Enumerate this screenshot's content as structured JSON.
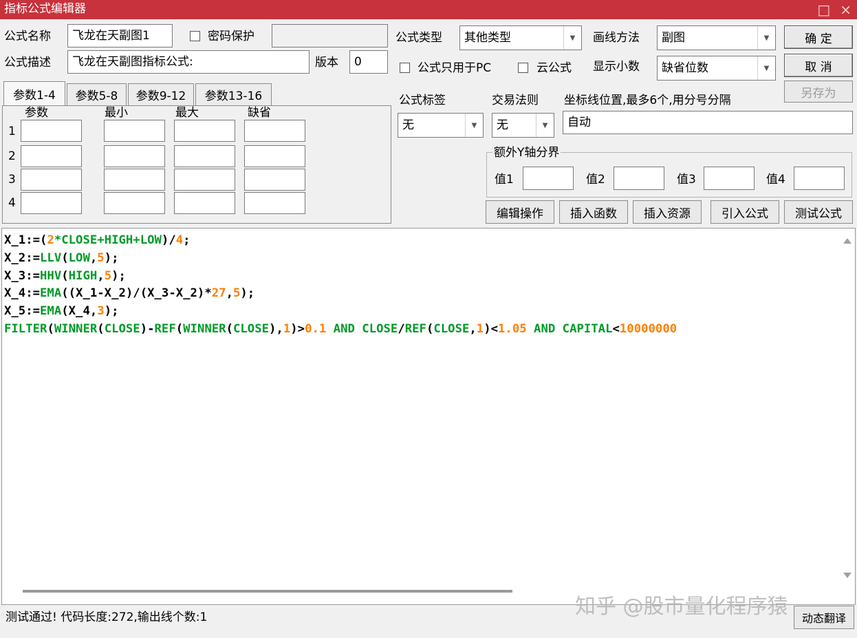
{
  "window": {
    "title": "指标公式编辑器",
    "maximize_glyph": "□",
    "close_glyph": "×"
  },
  "form": {
    "name_label": "公式名称",
    "name_value": "飞龙在天副图1",
    "password_label": "密码保护",
    "desc_label": "公式描述",
    "desc_value": "飞龙在天副图指标公式:",
    "version_label": "版本",
    "version_value": "0",
    "type_label": "公式类型",
    "type_value": "其他类型",
    "draw_label": "画线方法",
    "draw_value": "副图",
    "pc_only_label": "公式只用于PC",
    "cloud_label": "云公式",
    "decimal_label": "显示小数",
    "decimal_value": "缺省位数",
    "tag_label": "公式标签",
    "tag_value": "无",
    "trade_label": "交易法则",
    "trade_value": "无",
    "axis_label": "坐标线位置,最多6个,用分号分隔",
    "axis_value": "自动",
    "yaxis_group_label": "额外Y轴分界",
    "yvals": [
      "值1",
      "值2",
      "值3",
      "值4"
    ]
  },
  "buttons": {
    "ok": "确 定",
    "cancel": "取 消",
    "save_as": "另存为"
  },
  "tabs": [
    "参数1-4",
    "参数5-8",
    "参数9-12",
    "参数13-16"
  ],
  "params": {
    "headers": [
      "参数",
      "最小",
      "最大",
      "缺省"
    ],
    "rows": [
      "1",
      "2",
      "3",
      "4"
    ]
  },
  "actions": [
    "编辑操作",
    "插入函数",
    "插入资源",
    "引入公式",
    "测试公式"
  ],
  "code_lines": [
    [
      [
        "k",
        "X_1:=("
      ],
      [
        "o",
        "2"
      ],
      [
        "g",
        "*CLOSE+HIGH+LOW"
      ],
      [
        "k",
        ")/"
      ],
      [
        "o",
        "4"
      ],
      [
        "k",
        ";"
      ]
    ],
    [
      [
        "k",
        "X_2:="
      ],
      [
        "g",
        "LLV"
      ],
      [
        "k",
        "("
      ],
      [
        "g",
        "LOW"
      ],
      [
        "k",
        ","
      ],
      [
        "o",
        "5"
      ],
      [
        "k",
        ");"
      ]
    ],
    [
      [
        "k",
        "X_3:="
      ],
      [
        "g",
        "HHV"
      ],
      [
        "k",
        "("
      ],
      [
        "g",
        "HIGH"
      ],
      [
        "k",
        ","
      ],
      [
        "o",
        "5"
      ],
      [
        "k",
        ");"
      ]
    ],
    [
      [
        "k",
        "X_4:="
      ],
      [
        "g",
        "EMA"
      ],
      [
        "k",
        "((X_1-X_2)/(X_3-X_2)*"
      ],
      [
        "o",
        "27"
      ],
      [
        "k",
        ","
      ],
      [
        "o",
        "5"
      ],
      [
        "k",
        ");"
      ]
    ],
    [
      [
        "k",
        "X_5:="
      ],
      [
        "g",
        "EMA"
      ],
      [
        "k",
        "(X_4,"
      ],
      [
        "o",
        "3"
      ],
      [
        "k",
        ");"
      ]
    ],
    [
      [
        "g",
        "FILTER"
      ],
      [
        "k",
        "("
      ],
      [
        "g",
        "WINNER"
      ],
      [
        "k",
        "("
      ],
      [
        "g",
        "CLOSE"
      ],
      [
        "k",
        ")-"
      ],
      [
        "g",
        "REF"
      ],
      [
        "k",
        "("
      ],
      [
        "g",
        "WINNER"
      ],
      [
        "k",
        "("
      ],
      [
        "g",
        "CLOSE"
      ],
      [
        "k",
        "),"
      ],
      [
        "o",
        "1"
      ],
      [
        "k",
        ")>"
      ],
      [
        "o",
        "0.1"
      ],
      [
        "g",
        " AND CLOSE"
      ],
      [
        "k",
        "/"
      ],
      [
        "g",
        "REF"
      ],
      [
        "k",
        "("
      ],
      [
        "g",
        "CLOSE"
      ],
      [
        "k",
        ","
      ],
      [
        "o",
        "1"
      ],
      [
        "k",
        ")<"
      ],
      [
        "o",
        "1.05"
      ],
      [
        "g",
        " AND CAPITAL"
      ],
      [
        "k",
        "<"
      ],
      [
        "o",
        "10000000"
      ]
    ]
  ],
  "status": {
    "text": "测试通过! 代码长度:272,输出线个数:1",
    "dyn_translate": "动态翻译"
  },
  "watermark": "知乎 @股市量化程序猿"
}
